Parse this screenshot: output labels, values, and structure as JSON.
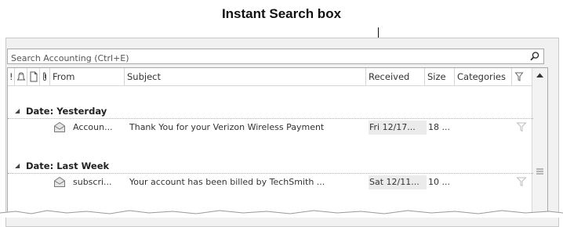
{
  "callout": {
    "label": "Instant Search box"
  },
  "search": {
    "placeholder": "Search Accounting (Ctrl+E)",
    "icon": "search-icon"
  },
  "columns": {
    "importance": "!",
    "from": "From",
    "subject": "Subject",
    "received": "Received",
    "size": "Size",
    "categories": "Categories"
  },
  "groups": [
    {
      "label": "Date: Yesterday",
      "rows": [
        {
          "from": "Accoun...",
          "subject": "Thank You for your Verizon Wireless Payment",
          "received": "Fri 12/17...",
          "size": "18 ..."
        }
      ]
    },
    {
      "label": "Date: Last Week",
      "rows": [
        {
          "from": "subscri...",
          "subject": "Your account has been billed by TechSmith ...",
          "received": "Sat 12/11...",
          "size": "10 ..."
        }
      ]
    }
  ]
}
